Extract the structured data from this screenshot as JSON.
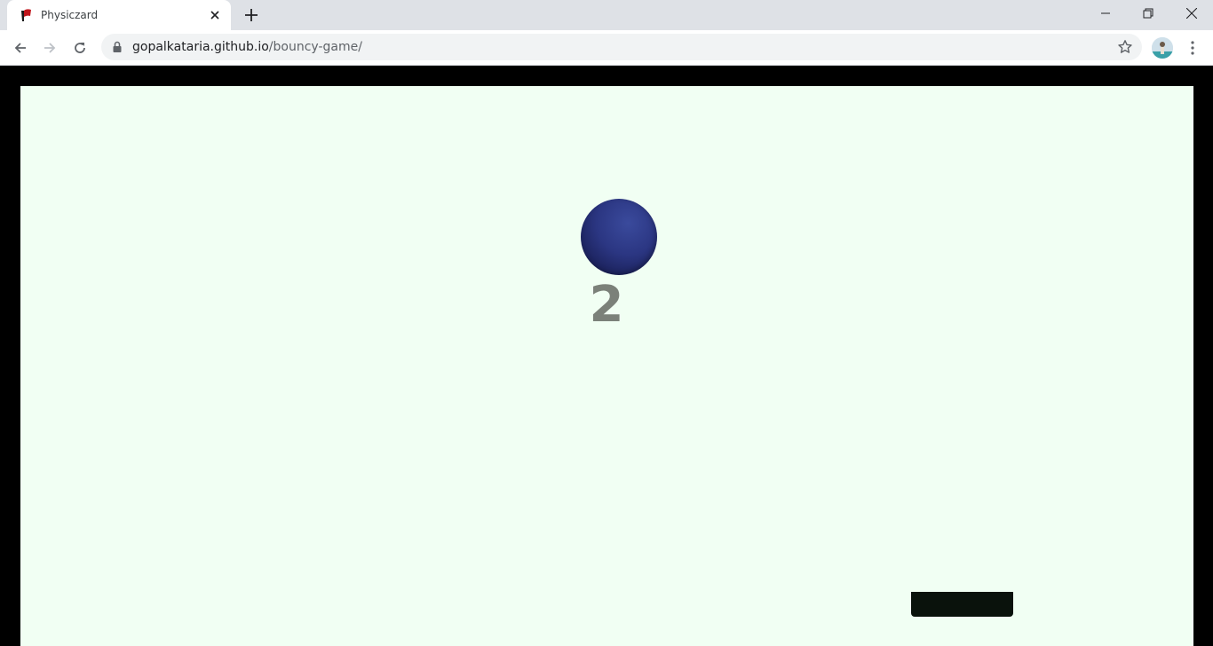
{
  "browser": {
    "tab": {
      "title": "Physiczard"
    },
    "address_bar": {
      "host": "gopalkataria.github.io",
      "path": "/bouncy-game/"
    }
  },
  "game": {
    "score": "2",
    "colors": {
      "background": "#f1fff3",
      "border": "#000000",
      "ball": "#2b3682",
      "paddle": "#0a120c",
      "score_text": "#7b8179"
    }
  }
}
